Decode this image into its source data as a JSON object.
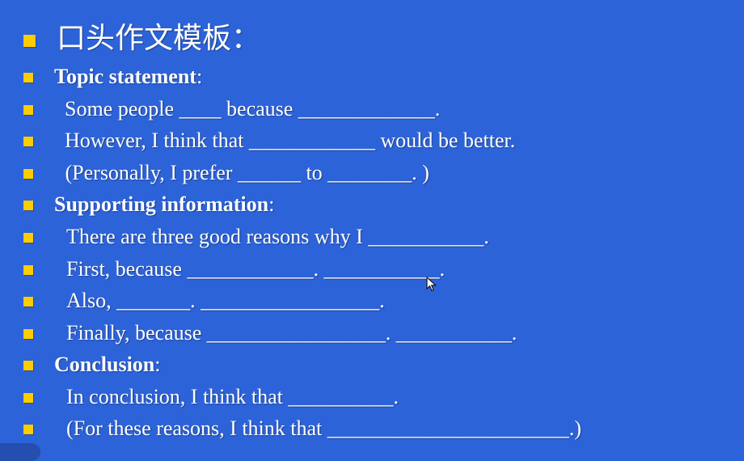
{
  "slide": {
    "title": "口头作文模板：",
    "lines": [
      {
        "text": "Topic statement",
        "suffix": ":",
        "bold": true
      },
      {
        "text": "  Some people ____ because _____________."
      },
      {
        "text": "  However, I think that ____________ would be better."
      },
      {
        "text": " (Personally, I prefer ______ to ________. )"
      },
      {
        "text": "Supporting information",
        "suffix": ":",
        "bold": true
      },
      {
        "text": "There are three good reasons why I ___________."
      },
      {
        "text": "First, because ____________. ___________."
      },
      {
        "text": "Also, _______. _________________."
      },
      {
        "text": "Finally, because _________________. ___________."
      },
      {
        "text": "Conclusion",
        "suffix": ":",
        "bold": true
      },
      {
        "text": "In conclusion, I think that __________."
      },
      {
        "text": "(For these reasons, I think that _______________________.)"
      }
    ]
  },
  "colors": {
    "background": "#2d63d8",
    "bullet": "#ffcc00",
    "text": "#ffffff"
  },
  "icons": {
    "bullet": "square-bullet-icon",
    "cursor": "mouse-cursor-icon"
  }
}
